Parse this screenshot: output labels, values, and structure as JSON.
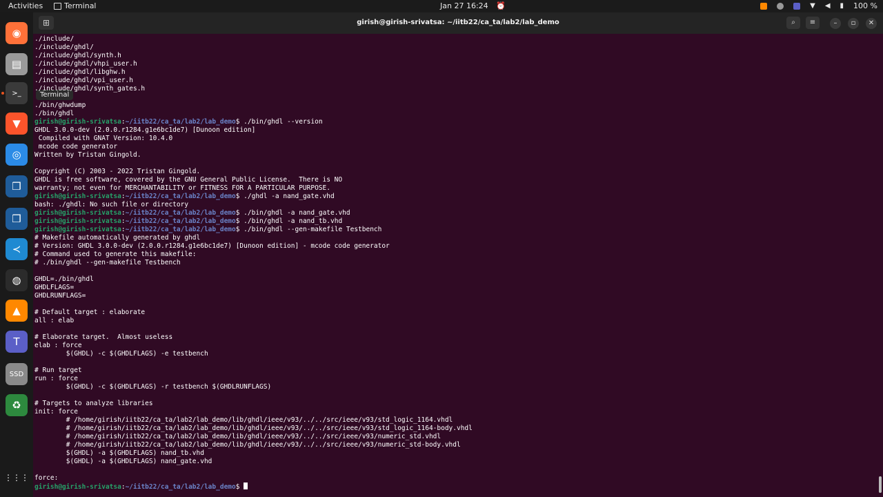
{
  "topbar": {
    "activities": "Activities",
    "app_name": "Terminal",
    "clock": "Jan 27  16:24",
    "battery": "100 %"
  },
  "dock": {
    "tooltip": "Terminal",
    "apps": [
      {
        "name": "firefox-icon",
        "color": "#ff7139",
        "glyph": "◉"
      },
      {
        "name": "files-icon",
        "color": "#9a9a9a",
        "glyph": "▤"
      },
      {
        "name": "terminal-icon",
        "color": "#3a3a3a",
        "glyph": ">_"
      },
      {
        "name": "brave-icon",
        "color": "#fb542b",
        "glyph": "▼"
      },
      {
        "name": "chrome-icon",
        "color": "#2b8be6",
        "glyph": "◎"
      },
      {
        "name": "virtualbox-icon",
        "color": "#1f5c99",
        "glyph": "❒"
      },
      {
        "name": "virtualbox-2-icon",
        "color": "#1f5c99",
        "glyph": "❒"
      },
      {
        "name": "vscode-icon",
        "color": "#1f8ad2",
        "glyph": "≺"
      },
      {
        "name": "obs-icon",
        "color": "#2b2b2b",
        "glyph": "◍"
      },
      {
        "name": "vlc-icon",
        "color": "#ff8800",
        "glyph": "▲"
      },
      {
        "name": "teams-icon",
        "color": "#5b5fc7",
        "glyph": "T"
      },
      {
        "name": "ssd-icon",
        "color": "#8a8a8a",
        "glyph": "SSD"
      },
      {
        "name": "trash-icon",
        "color": "#2d8a3e",
        "glyph": "♻"
      }
    ],
    "apps_grid": "⋮⋮⋮"
  },
  "window": {
    "title": "girish@girish-srivatsa: ~/iitb22/ca_ta/lab2/lab_demo"
  },
  "colors": {
    "terminal_bg": "#300a24",
    "user": "#26a269",
    "path": "#6a83c8"
  },
  "prompt": {
    "user": "girish@girish-srivatsa",
    "path": "~/iitb22/ca_ta/lab2/lab_demo"
  },
  "lines": [
    {
      "t": "./include/"
    },
    {
      "t": "./include/ghdl/"
    },
    {
      "t": "./include/ghdl/synth.h"
    },
    {
      "t": "./include/ghdl/vhpi_user.h"
    },
    {
      "t": "./include/ghdl/libghw.h"
    },
    {
      "t": "./include/ghdl/vpi_user.h"
    },
    {
      "t": "./include/ghdl/synth_gates.h"
    },
    {
      "t": ""
    },
    {
      "t": "./bin/ghwdump"
    },
    {
      "t": "./bin/ghdl"
    },
    {
      "p": true,
      "t": "$ ./bin/ghdl --version"
    },
    {
      "t": "GHDL 3.0.0-dev (2.0.0.r1284.g1e6bc1de7) [Dunoon edition]"
    },
    {
      "t": " Compiled with GNAT Version: 10.4.0"
    },
    {
      "t": " mcode code generator"
    },
    {
      "t": "Written by Tristan Gingold."
    },
    {
      "t": ""
    },
    {
      "t": "Copyright (C) 2003 - 2022 Tristan Gingold."
    },
    {
      "t": "GHDL is free software, covered by the GNU General Public License.  There is NO"
    },
    {
      "t": "warranty; not even for MERCHANTABILITY or FITNESS FOR A PARTICULAR PURPOSE."
    },
    {
      "p": true,
      "t": "$ ./ghdl -a nand_gate.vhd"
    },
    {
      "t": "bash: ./ghdl: No such file or directory"
    },
    {
      "p": true,
      "t": "$ ./bin/ghdl -a nand_gate.vhd"
    },
    {
      "p": true,
      "t": "$ ./bin/ghdl -a nand_tb.vhd"
    },
    {
      "p": true,
      "t": "$ ./bin/ghdl --gen-makefile Testbench"
    },
    {
      "t": "# Makefile automatically generated by ghdl"
    },
    {
      "t": "# Version: GHDL 3.0.0-dev (2.0.0.r1284.g1e6bc1de7) [Dunoon edition] - mcode code generator"
    },
    {
      "t": "# Command used to generate this makefile:"
    },
    {
      "t": "# ./bin/ghdl --gen-makefile Testbench"
    },
    {
      "t": ""
    },
    {
      "t": "GHDL=./bin/ghdl"
    },
    {
      "t": "GHDLFLAGS="
    },
    {
      "t": "GHDLRUNFLAGS="
    },
    {
      "t": ""
    },
    {
      "t": "# Default target : elaborate"
    },
    {
      "t": "all : elab"
    },
    {
      "t": ""
    },
    {
      "t": "# Elaborate target.  Almost useless"
    },
    {
      "t": "elab : force"
    },
    {
      "t": "        $(GHDL) -c $(GHDLFLAGS) -e testbench"
    },
    {
      "t": ""
    },
    {
      "t": "# Run target"
    },
    {
      "t": "run : force"
    },
    {
      "t": "        $(GHDL) -c $(GHDLFLAGS) -r testbench $(GHDLRUNFLAGS)"
    },
    {
      "t": ""
    },
    {
      "t": "# Targets to analyze libraries"
    },
    {
      "t": "init: force"
    },
    {
      "t": "        # /home/girish/iitb22/ca_ta/lab2/lab_demo/lib/ghdl/ieee/v93/../../src/ieee/v93/std_logic_1164.vhdl"
    },
    {
      "t": "        # /home/girish/iitb22/ca_ta/lab2/lab_demo/lib/ghdl/ieee/v93/../../src/ieee/v93/std_logic_1164-body.vhdl"
    },
    {
      "t": "        # /home/girish/iitb22/ca_ta/lab2/lab_demo/lib/ghdl/ieee/v93/../../src/ieee/v93/numeric_std.vhdl"
    },
    {
      "t": "        # /home/girish/iitb22/ca_ta/lab2/lab_demo/lib/ghdl/ieee/v93/../../src/ieee/v93/numeric_std-body.vhdl"
    },
    {
      "t": "        $(GHDL) -a $(GHDLFLAGS) nand_tb.vhd"
    },
    {
      "t": "        $(GHDL) -a $(GHDLFLAGS) nand_gate.vhd"
    },
    {
      "t": ""
    },
    {
      "t": "force:"
    },
    {
      "p": true,
      "t": "$ ",
      "cursor": true
    }
  ]
}
